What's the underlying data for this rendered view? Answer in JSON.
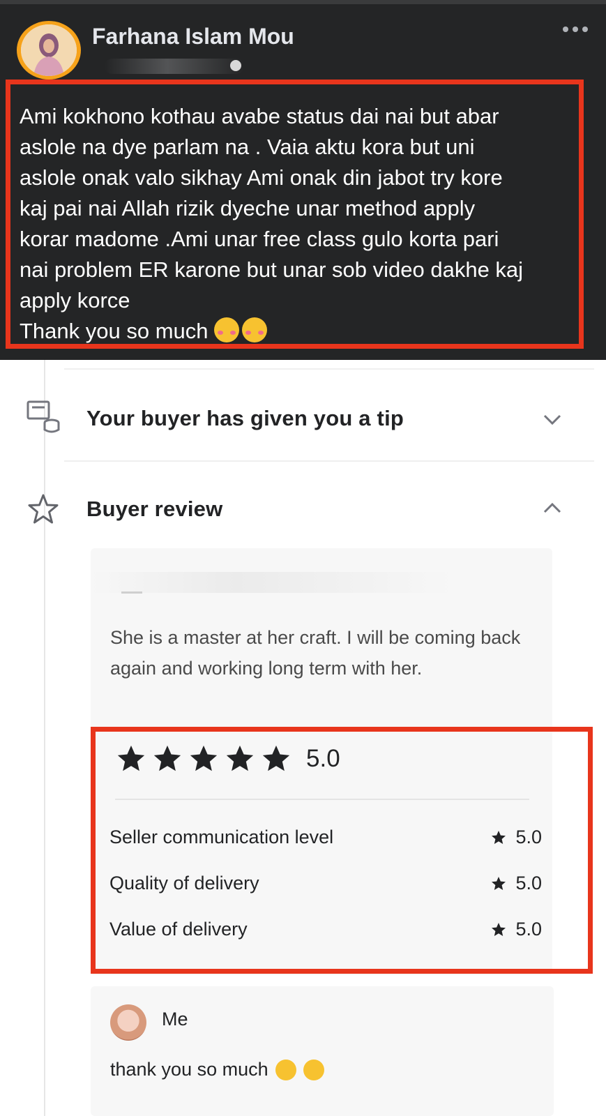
{
  "post": {
    "author": "Farhana Islam Mou",
    "text_lines": [
      "Ami kokhono kothau avabe status dai nai but abar",
      "aslole na dye parlam na . Vaia aktu kora but uni",
      "aslole onak valo sikhay Ami onak din jabot try kore",
      "kaj pai nai Allah rizik dyeche unar method apply",
      "korar madome .Ami unar free class gulo korta pari",
      "nai problem ER karone but unar sob video dakhe kaj",
      "apply korce"
    ],
    "thanks_line": "Thank you so much",
    "thanks_emojis": [
      "smiling-blush-emoji",
      "smiling-blush-emoji"
    ]
  },
  "fiverr": {
    "tip_label": "Your buyer has given you a tip",
    "review_section_label": "Buyer review",
    "review_text": "She is a master at her craft. I will be coming back again and working long term with her.",
    "overall_rating": "5.0",
    "overall_stars": 5,
    "sub_ratings": [
      {
        "label": "Seller communication level",
        "score": "5.0"
      },
      {
        "label": "Quality of delivery",
        "score": "5.0"
      },
      {
        "label": "Value of delivery",
        "score": "5.0"
      }
    ],
    "reply": {
      "name": "Me",
      "text": "thank you so much"
    }
  },
  "colors": {
    "fb_background": "#242526",
    "highlight_border": "#e8351c",
    "avatar_ring": "#f6a21a"
  }
}
